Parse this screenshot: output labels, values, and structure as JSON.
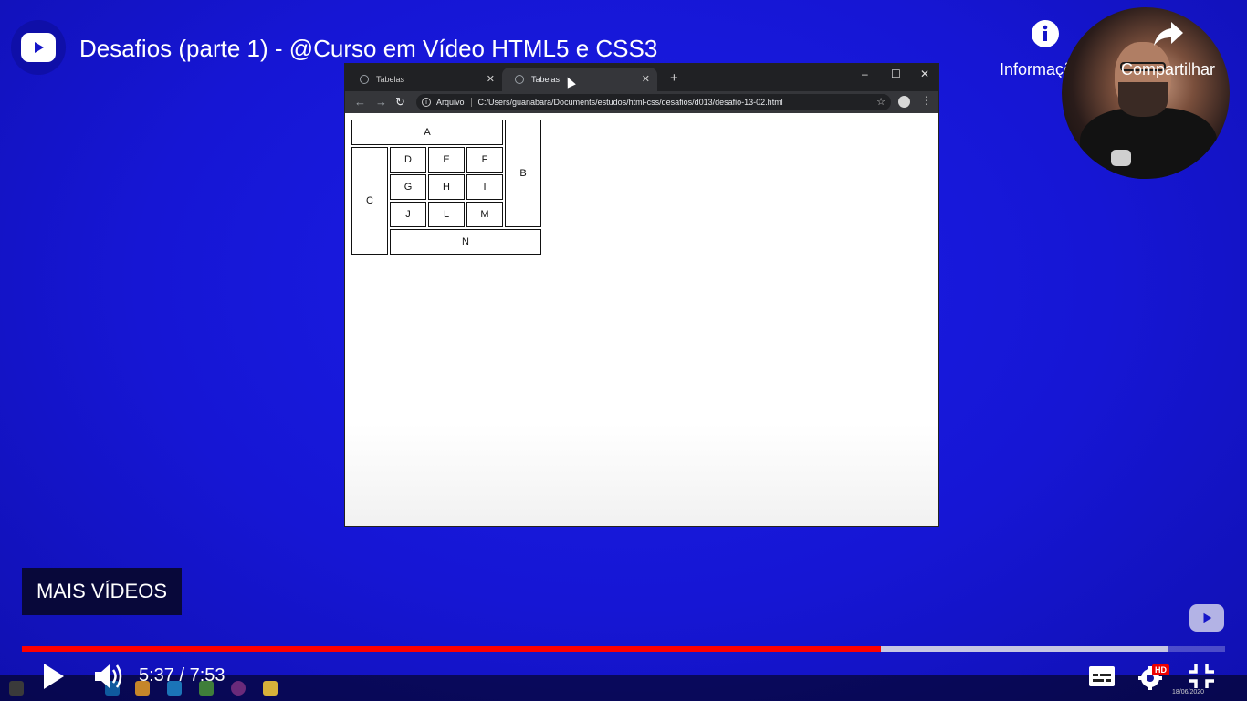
{
  "video": {
    "title": "Desafios (parte 1) - @Curso em Vídeo HTML5 e CSS3",
    "actions": {
      "info_label": "Informações",
      "share_label": "Compartilhar"
    },
    "more_videos_label": "MAIS VÍDEOS",
    "time_display": "5:37 / 7:53",
    "progress": {
      "played_fraction": 0.714,
      "buffered_fraction": 0.952
    },
    "hd_label": "HD",
    "accent_color": "#ff0000"
  },
  "browser": {
    "tabs": [
      {
        "label": "Tabelas",
        "active": false
      },
      {
        "label": "Tabelas",
        "active": true
      }
    ],
    "address": {
      "scheme_label": "Arquivo",
      "url": "C:/Users/guanabara/Documents/estudos/html-css/desafios/d013/desafio-13-02.html"
    },
    "table": {
      "A": "A",
      "B": "B",
      "C": "C",
      "D": "D",
      "E": "E",
      "F": "F",
      "G": "G",
      "H": "H",
      "I": "I",
      "J": "J",
      "L": "L",
      "M": "M",
      "N": "N"
    }
  },
  "taskbar": {
    "date": "18/06/2020"
  },
  "icons": [
    "youtube-logo-icon",
    "info-icon",
    "share-icon",
    "play-icon",
    "volume-icon",
    "subtitles-icon",
    "settings-icon",
    "exit-fullscreen-icon",
    "globe-icon",
    "close-icon",
    "plus-icon",
    "back-icon",
    "forward-icon",
    "reload-icon",
    "star-icon",
    "profile-icon",
    "menu-icon"
  ]
}
